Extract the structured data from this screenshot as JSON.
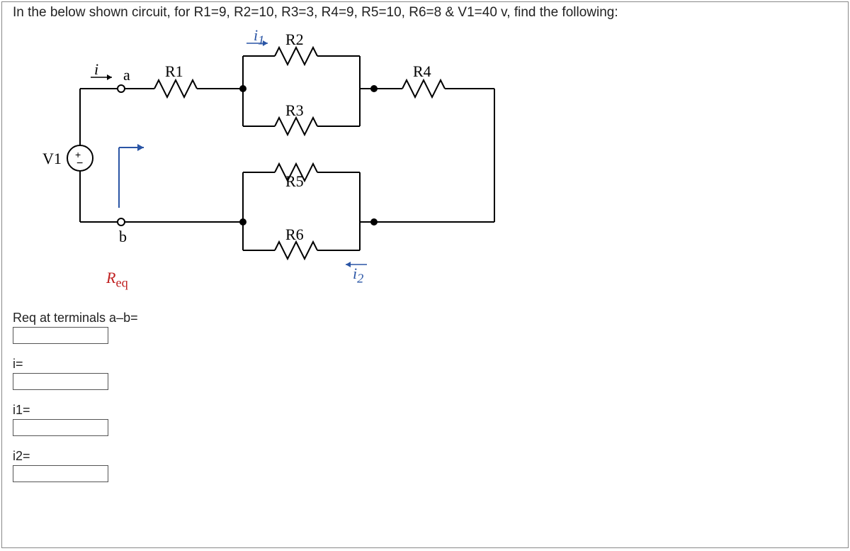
{
  "question": "In the below shown circuit, for R1=9, R2=10, R3=3, R4=9, R5=10, R6=8 & V1=40 v, find the following:",
  "circuit": {
    "V1": "V1",
    "R1": "R1",
    "R2": "R2",
    "R3": "R3",
    "R4": "R4",
    "R5": "R5",
    "R6": "R6",
    "i": "i",
    "a": "a",
    "b": "b",
    "Req": "R",
    "Req_sub": "eq",
    "i1": "i",
    "i1_sub": "1",
    "i2": "i",
    "i2_sub": "2",
    "plus": "+",
    "minus": "−"
  },
  "answers": {
    "req_label": "Req at terminals a–b=",
    "i_label": "i=",
    "i1_label": "i1=",
    "i2_label": "i2="
  }
}
